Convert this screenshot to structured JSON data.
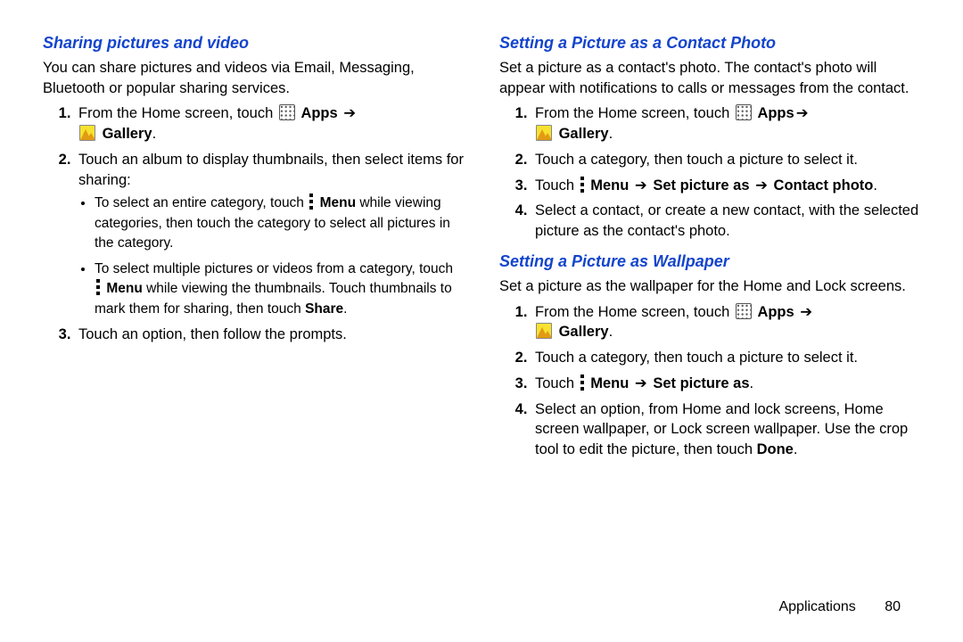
{
  "left": {
    "h1": "Sharing pictures and video",
    "intro": "You can share pictures and videos via Email, Messaging, Bluetooth or popular sharing services.",
    "step1_a": "From the Home screen, touch ",
    "step1_apps": " Apps ",
    "step1_gallery": "Gallery",
    "step2": "Touch an album to display thumbnails, then select items for sharing:",
    "b1_a": "To select an entire category, touch ",
    "b1_menu": "Menu",
    "b1_b": " while viewing categories, then touch the category to select all pictures in the category.",
    "b2_a": "To select multiple pictures or videos from a category, touch ",
    "b2_menu": "Menu",
    "b2_b": " while viewing the thumbnails. Touch thumbnails to mark them for sharing, then touch ",
    "b2_share": "Share",
    "step3": "Touch an option, then follow the prompts."
  },
  "right": {
    "h1": "Setting a Picture as a Contact Photo",
    "intro": "Set a picture as a contact's photo. The contact's photo will appear with notifications to calls or messages from the contact.",
    "c_step1_a": "From the Home screen, touch ",
    "c_step1_apps": " Apps",
    "c_step1_gallery": "Gallery",
    "c_step2": "Touch a category, then touch a picture to select it.",
    "c_step3_a": "Touch ",
    "c_step3_menu": "Menu ",
    "c_step3_setpic": " Set picture as ",
    "c_step3_contact": " Contact photo",
    "c_step4": "Select a contact, or create a new contact, with the selected picture as the contact's photo.",
    "h2": "Setting a Picture as Wallpaper",
    "w_intro": "Set a picture as the wallpaper for the Home and Lock screens.",
    "w_step1_a": "From the Home screen, touch ",
    "w_step1_apps": " Apps ",
    "w_step1_gallery": "Gallery",
    "w_step2": "Touch a category, then touch a picture to select it.",
    "w_step3_a": "Touch ",
    "w_step3_menu": "Menu ",
    "w_step3_setpic": " Set picture as",
    "w_step4_a": "Select an option, from Home and lock screens, Home screen wallpaper, or Lock screen wallpaper. Use the crop tool to edit the picture, then touch ",
    "w_step4_done": "Done"
  },
  "symbols": {
    "arrow": "➔",
    "dot": "."
  },
  "footer": {
    "section": "Applications",
    "page": "80"
  }
}
